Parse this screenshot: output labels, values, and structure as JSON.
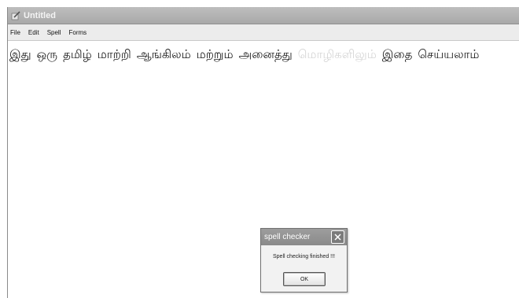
{
  "window": {
    "title": "Untitled",
    "title_icon": "notepad-pen-icon"
  },
  "menubar": {
    "items": [
      "File",
      "Edit",
      "Spell",
      "Forms"
    ]
  },
  "editor": {
    "words": [
      {
        "text": "இது",
        "misspelled": false
      },
      {
        "text": "ஒரு",
        "misspelled": false
      },
      {
        "text": "தமிழ்",
        "misspelled": false
      },
      {
        "text": "மாற்றி",
        "misspelled": false
      },
      {
        "text": "ஆங்கிலம்",
        "misspelled": false
      },
      {
        "text": "மற்றும்",
        "misspelled": false
      },
      {
        "text": "அனைத்து",
        "misspelled": false
      },
      {
        "text": "மொழிகளிலும்",
        "misspelled": true
      },
      {
        "text": "இதை",
        "misspelled": false
      },
      {
        "text": "செய்யலாம்",
        "misspelled": false
      }
    ],
    "misspelled_color": "#d6d6d6"
  },
  "dialog": {
    "title": "spell checker",
    "message": "Spell checking finished !!!",
    "ok_label": "OK",
    "close_icon": "close-icon"
  }
}
